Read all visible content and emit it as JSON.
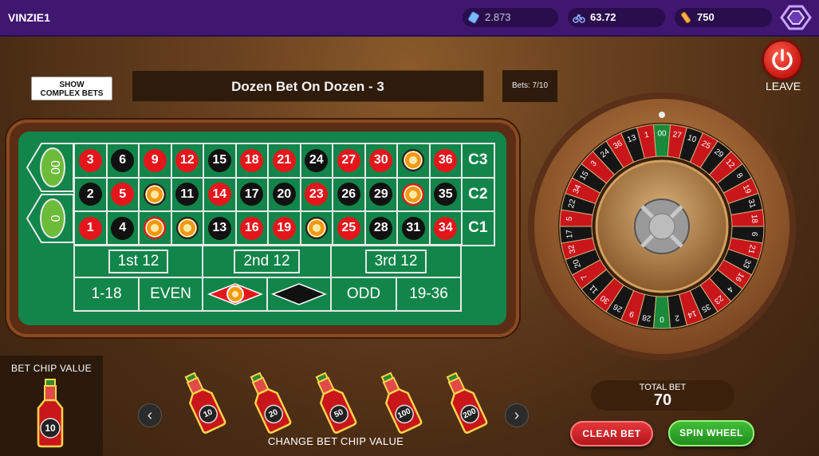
{
  "topbar": {
    "username": "VINZIE1",
    "stat1": "2.873",
    "stat2": "63.72",
    "stat3": "750"
  },
  "controls": {
    "complex_bets_label": "SHOW\nCOMPLEX BETS",
    "bet_title": "Dozen Bet On Dozen - 3",
    "bets_count": "Bets: 7/10",
    "leave_label": "LEAVE"
  },
  "table": {
    "zeros": [
      "00",
      "0"
    ],
    "rows": [
      [
        "3",
        "6",
        "9",
        "12",
        "15",
        "18",
        "21",
        "24",
        "27",
        "30",
        "33",
        "36"
      ],
      [
        "2",
        "5",
        "8",
        "11",
        "14",
        "17",
        "20",
        "23",
        "26",
        "29",
        "32",
        "35"
      ],
      [
        "1",
        "4",
        "7",
        "10",
        "13",
        "16",
        "19",
        "22",
        "25",
        "28",
        "31",
        "34"
      ]
    ],
    "colors": [
      [
        "red",
        "black",
        "red",
        "red",
        "black",
        "red",
        "red",
        "black",
        "red",
        "red",
        "black",
        "red"
      ],
      [
        "black",
        "red",
        "black",
        "black",
        "red",
        "black",
        "black",
        "red",
        "black",
        "black",
        "red",
        "black"
      ],
      [
        "red",
        "black",
        "red",
        "black",
        "black",
        "red",
        "red",
        "black",
        "red",
        "black",
        "black",
        "red"
      ]
    ],
    "chips_on": [
      "33",
      "8",
      "32",
      "7",
      "10",
      "22"
    ],
    "column_labels": [
      "C3",
      "C2",
      "C1"
    ],
    "dozens": [
      "1st 12",
      "2nd 12",
      "3rd 12"
    ],
    "outside": [
      "1-18",
      "EVEN",
      "ODD",
      "19-36"
    ]
  },
  "wheel": {
    "outer_numbers": [
      "0",
      "28",
      "9",
      "26",
      "30",
      "11",
      "7",
      "20",
      "32",
      "17",
      "5",
      "22",
      "34",
      "15",
      "3",
      "24",
      "36",
      "13",
      "1",
      "00",
      "27",
      "10",
      "25",
      "29",
      "12",
      "8",
      "19",
      "31",
      "18",
      "6",
      "21",
      "33",
      "16",
      "4",
      "23",
      "35",
      "14",
      "2"
    ]
  },
  "bottom": {
    "chip_value_label": "BET CHIP VALUE",
    "selected_chip": "10",
    "chip_values": [
      "10",
      "20",
      "50",
      "100",
      "200"
    ],
    "change_label": "CHANGE BET CHIP VALUE",
    "total_label": "TOTAL BET",
    "total_value": "70",
    "clear_label": "CLEAR BET",
    "spin_label": "SPIN WHEEL"
  }
}
